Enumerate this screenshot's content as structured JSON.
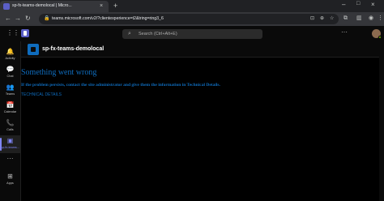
{
  "browser": {
    "tab_title": "sp-fx-teams-demolocal | Micro...",
    "tab_close": "×",
    "new_tab": "+",
    "url": "teams.microsoft.com/v2/?clientexperience=t2&tring=ring3_6",
    "window_controls": {
      "minimize": "–",
      "maximize": "□",
      "close": "×"
    }
  },
  "teams": {
    "search_placeholder": "Search (Ctrl+Alt+E)",
    "more_label": "···",
    "rail": [
      {
        "id": "activity",
        "icon": "bell-icon",
        "glyph": "🔔",
        "label": "Activity"
      },
      {
        "id": "chat",
        "icon": "chat-icon",
        "glyph": "💬",
        "label": "Chat"
      },
      {
        "id": "teams",
        "icon": "teams-icon",
        "glyph": "👥",
        "label": "Teams"
      },
      {
        "id": "calendar",
        "icon": "calendar-icon",
        "glyph": "📅",
        "label": "Calendar"
      },
      {
        "id": "calls",
        "icon": "phone-icon",
        "glyph": "📞",
        "label": "Calls"
      },
      {
        "id": "sp-fx",
        "icon": "app-icon",
        "glyph": "▣",
        "label": "sp-fx-teams..."
      },
      {
        "id": "more",
        "icon": "more-icon",
        "glyph": "···",
        "label": ""
      },
      {
        "id": "apps",
        "icon": "plus-icon",
        "glyph": "⊞",
        "label": "Apps"
      }
    ],
    "app_title": "sp-fx-teams-demolocal"
  },
  "content": {
    "error_title": "Something went wrong",
    "error_message": "If the problem persists, contact the site administrator and give them the information in Technical Details.",
    "technical_details": "TECHNICAL DETAILS"
  },
  "colors": {
    "accent": "#7f85f5",
    "link_blue": "#0f6cbd",
    "teams_purple": "#5b5fc7"
  }
}
